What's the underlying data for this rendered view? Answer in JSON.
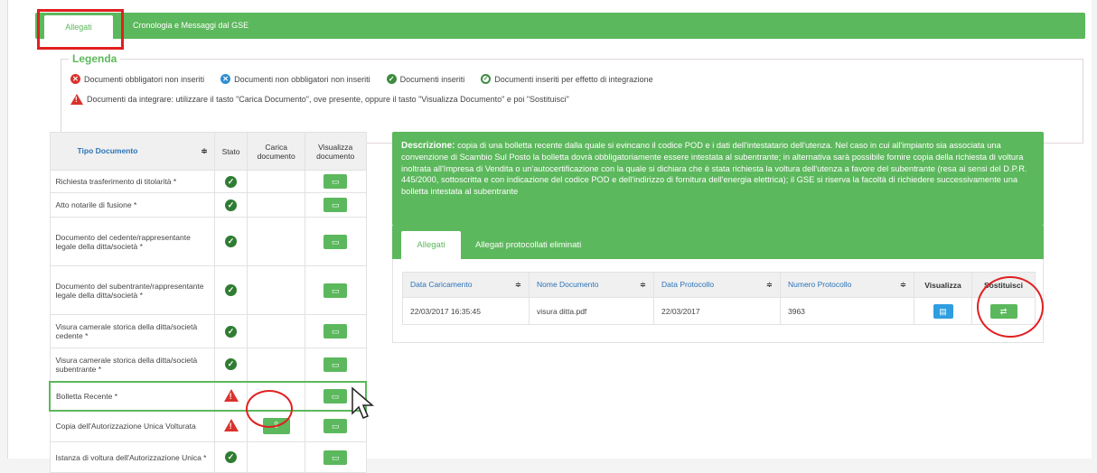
{
  "tabs": [
    {
      "label": "Allegati",
      "active": true
    },
    {
      "label": "Cronologia e Messaggi dal GSE",
      "active": false
    }
  ],
  "legend": {
    "title": "Legenda",
    "items_row1": [
      {
        "icon": "x-red-circle-icon",
        "label": "Documenti obbligatori non inseriti"
      },
      {
        "icon": "x-blue-circle-icon",
        "label": "Documenti non obbligatori non inseriti"
      },
      {
        "icon": "check-green-circle-icon",
        "label": "Documenti inseriti"
      },
      {
        "icon": "check-outline-circle-icon",
        "label": "Documenti inseriti per effetto di integrazione"
      }
    ],
    "note": {
      "icon": "warning-triangle-icon",
      "label": "Documenti da integrare: utilizzare il tasto \"Carica Documento\", ove presente, oppure il tasto \"Visualizza Documento\" e poi \"Sostituisci\""
    }
  },
  "doc_table": {
    "headers": {
      "tipo": "Tipo Documento",
      "stato": "Stato",
      "carica": "Carica documento",
      "visualizza": "Visualizza documento",
      "sort_glyph": "≑"
    },
    "rows": [
      {
        "name": "Richiesta trasferimento di titolarità *",
        "status": "ok",
        "upload": false
      },
      {
        "name": "Atto notarile di fusione *",
        "status": "ok",
        "upload": false
      },
      {
        "name": "Documento del cedente/rappresentante legale della ditta/società *",
        "status": "ok",
        "upload": false
      },
      {
        "name": "Documento del subentrante/rappresentante legale della ditta/società *",
        "status": "ok",
        "upload": false
      },
      {
        "name": "Visura camerale storica della ditta/società cedente *",
        "status": "ok",
        "upload": false
      },
      {
        "name": "Visura camerale storica della ditta/società subentrante *",
        "status": "ok",
        "upload": false
      },
      {
        "name": "Bolletta Recente *",
        "status": "warn",
        "upload": false
      },
      {
        "name": "Copia dell'Autorizzazione Unica Volturata",
        "status": "warn",
        "upload": true
      },
      {
        "name": "Istanza di voltura dell'Autorizzazione Unica *",
        "status": "ok",
        "upload": false
      }
    ]
  },
  "description": {
    "label": "Descrizione:",
    "text": "copia di una bolletta recente dalla quale si evincano il codice POD e i dati dell'intestatario dell'utenza. Nel caso in cui all'impianto sia associata una convenzione di Scambio Sul Posto la bolletta dovrà obbligatoriamente essere intestata al subentrante; in alternativa sarà possibile fornire copia della richiesta di voltura inoltrata all'Impresa di Vendita o un'autocertificazione con la quale si dichiara che è stata richiesta la voltura dell'utenza a favore del subentrante (resa ai sensi del D.P.R. 445/2000, sottoscritta e con indicazione del codice POD e dell'indirizzo di fornitura dell'energia elettrica); il GSE si riserva la facoltà di richiedere successivamente una bolletta intestata al subentrante"
  },
  "inner_tabs": [
    {
      "label": "Allegati",
      "active": true
    },
    {
      "label": "Allegati protocollati eliminati",
      "active": false
    }
  ],
  "att_table": {
    "headers": {
      "data_caricamento": "Data Caricamento",
      "nome": "Nome Documento",
      "data_protocollo": "Data Protocollo",
      "numero": "Numero Protocollo",
      "visualizza": "Visualizza",
      "sostituisci": "Sostituisci"
    },
    "rows": [
      {
        "data_caricamento": "22/03/2017 16:35:45",
        "nome": "visura ditta.pdf",
        "data_protocollo": "22/03/2017",
        "numero": "3963"
      }
    ]
  },
  "colors": {
    "green": "#5cb85c",
    "red": "#d9322c",
    "blue": "#2f9ee0",
    "highlight": "#e02020"
  }
}
